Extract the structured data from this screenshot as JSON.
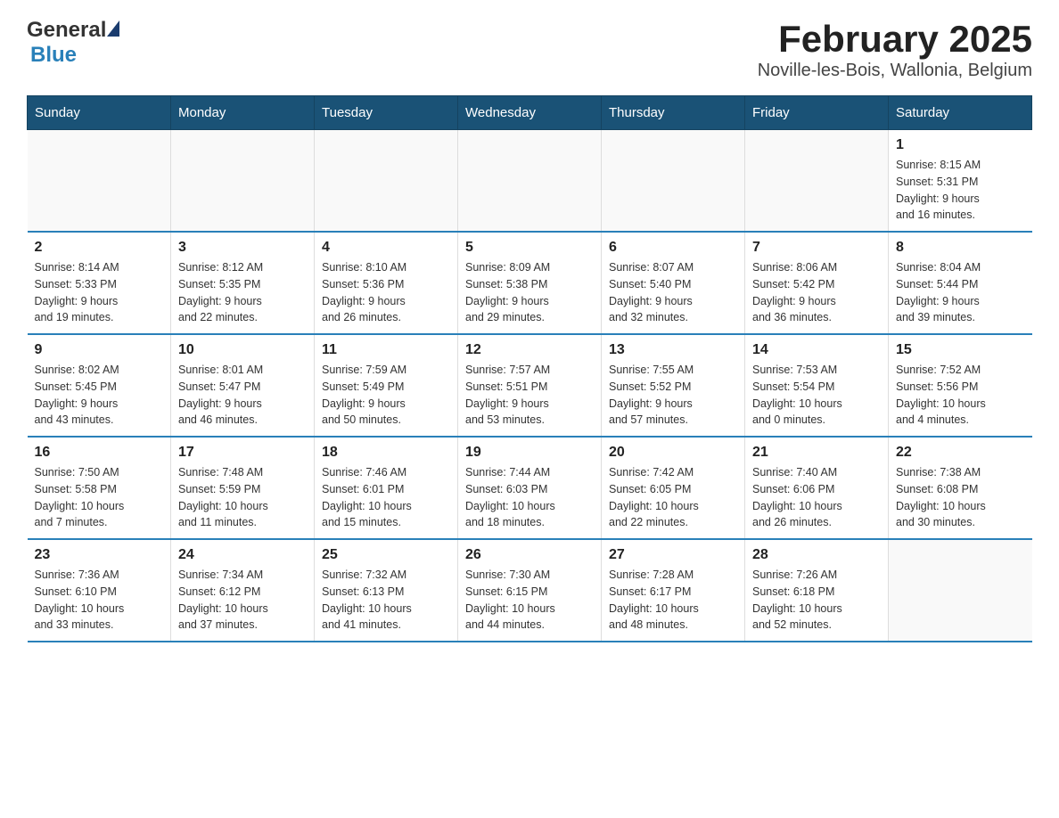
{
  "header": {
    "logo_general": "General",
    "logo_blue": "Blue",
    "title": "February 2025",
    "subtitle": "Noville-les-Bois, Wallonia, Belgium"
  },
  "days_of_week": [
    "Sunday",
    "Monday",
    "Tuesday",
    "Wednesday",
    "Thursday",
    "Friday",
    "Saturday"
  ],
  "weeks": [
    [
      {
        "day": "",
        "info": ""
      },
      {
        "day": "",
        "info": ""
      },
      {
        "day": "",
        "info": ""
      },
      {
        "day": "",
        "info": ""
      },
      {
        "day": "",
        "info": ""
      },
      {
        "day": "",
        "info": ""
      },
      {
        "day": "1",
        "info": "Sunrise: 8:15 AM\nSunset: 5:31 PM\nDaylight: 9 hours\nand 16 minutes."
      }
    ],
    [
      {
        "day": "2",
        "info": "Sunrise: 8:14 AM\nSunset: 5:33 PM\nDaylight: 9 hours\nand 19 minutes."
      },
      {
        "day": "3",
        "info": "Sunrise: 8:12 AM\nSunset: 5:35 PM\nDaylight: 9 hours\nand 22 minutes."
      },
      {
        "day": "4",
        "info": "Sunrise: 8:10 AM\nSunset: 5:36 PM\nDaylight: 9 hours\nand 26 minutes."
      },
      {
        "day": "5",
        "info": "Sunrise: 8:09 AM\nSunset: 5:38 PM\nDaylight: 9 hours\nand 29 minutes."
      },
      {
        "day": "6",
        "info": "Sunrise: 8:07 AM\nSunset: 5:40 PM\nDaylight: 9 hours\nand 32 minutes."
      },
      {
        "day": "7",
        "info": "Sunrise: 8:06 AM\nSunset: 5:42 PM\nDaylight: 9 hours\nand 36 minutes."
      },
      {
        "day": "8",
        "info": "Sunrise: 8:04 AM\nSunset: 5:44 PM\nDaylight: 9 hours\nand 39 minutes."
      }
    ],
    [
      {
        "day": "9",
        "info": "Sunrise: 8:02 AM\nSunset: 5:45 PM\nDaylight: 9 hours\nand 43 minutes."
      },
      {
        "day": "10",
        "info": "Sunrise: 8:01 AM\nSunset: 5:47 PM\nDaylight: 9 hours\nand 46 minutes."
      },
      {
        "day": "11",
        "info": "Sunrise: 7:59 AM\nSunset: 5:49 PM\nDaylight: 9 hours\nand 50 minutes."
      },
      {
        "day": "12",
        "info": "Sunrise: 7:57 AM\nSunset: 5:51 PM\nDaylight: 9 hours\nand 53 minutes."
      },
      {
        "day": "13",
        "info": "Sunrise: 7:55 AM\nSunset: 5:52 PM\nDaylight: 9 hours\nand 57 minutes."
      },
      {
        "day": "14",
        "info": "Sunrise: 7:53 AM\nSunset: 5:54 PM\nDaylight: 10 hours\nand 0 minutes."
      },
      {
        "day": "15",
        "info": "Sunrise: 7:52 AM\nSunset: 5:56 PM\nDaylight: 10 hours\nand 4 minutes."
      }
    ],
    [
      {
        "day": "16",
        "info": "Sunrise: 7:50 AM\nSunset: 5:58 PM\nDaylight: 10 hours\nand 7 minutes."
      },
      {
        "day": "17",
        "info": "Sunrise: 7:48 AM\nSunset: 5:59 PM\nDaylight: 10 hours\nand 11 minutes."
      },
      {
        "day": "18",
        "info": "Sunrise: 7:46 AM\nSunset: 6:01 PM\nDaylight: 10 hours\nand 15 minutes."
      },
      {
        "day": "19",
        "info": "Sunrise: 7:44 AM\nSunset: 6:03 PM\nDaylight: 10 hours\nand 18 minutes."
      },
      {
        "day": "20",
        "info": "Sunrise: 7:42 AM\nSunset: 6:05 PM\nDaylight: 10 hours\nand 22 minutes."
      },
      {
        "day": "21",
        "info": "Sunrise: 7:40 AM\nSunset: 6:06 PM\nDaylight: 10 hours\nand 26 minutes."
      },
      {
        "day": "22",
        "info": "Sunrise: 7:38 AM\nSunset: 6:08 PM\nDaylight: 10 hours\nand 30 minutes."
      }
    ],
    [
      {
        "day": "23",
        "info": "Sunrise: 7:36 AM\nSunset: 6:10 PM\nDaylight: 10 hours\nand 33 minutes."
      },
      {
        "day": "24",
        "info": "Sunrise: 7:34 AM\nSunset: 6:12 PM\nDaylight: 10 hours\nand 37 minutes."
      },
      {
        "day": "25",
        "info": "Sunrise: 7:32 AM\nSunset: 6:13 PM\nDaylight: 10 hours\nand 41 minutes."
      },
      {
        "day": "26",
        "info": "Sunrise: 7:30 AM\nSunset: 6:15 PM\nDaylight: 10 hours\nand 44 minutes."
      },
      {
        "day": "27",
        "info": "Sunrise: 7:28 AM\nSunset: 6:17 PM\nDaylight: 10 hours\nand 48 minutes."
      },
      {
        "day": "28",
        "info": "Sunrise: 7:26 AM\nSunset: 6:18 PM\nDaylight: 10 hours\nand 52 minutes."
      },
      {
        "day": "",
        "info": ""
      }
    ]
  ]
}
